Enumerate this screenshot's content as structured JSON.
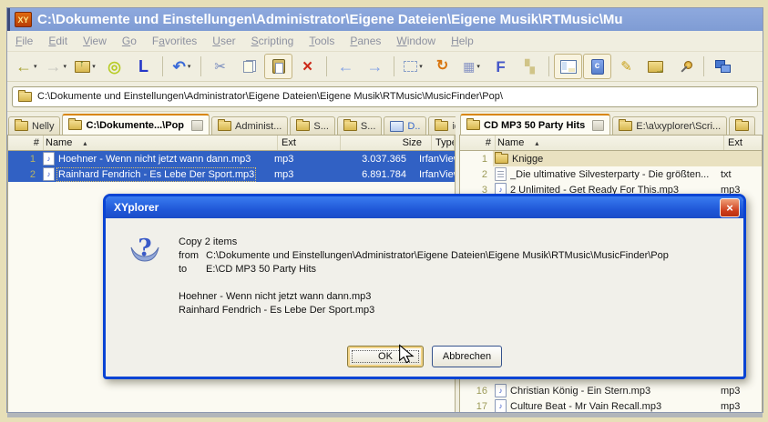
{
  "colors": {
    "selection": "#3161c4",
    "highlight": "#e9e1c0",
    "dialog_border": "#0a44d4",
    "tab_accent": "#d8860e",
    "titlebar": "#7f9cd4"
  },
  "window": {
    "logo": "XY",
    "title": "C:\\Dokumente und Einstellungen\\Administrator\\Eigene Dateien\\Eigene Musik\\RTMusic\\Mu"
  },
  "menu": {
    "items": [
      {
        "pre": "",
        "key": "F",
        "post": "ile"
      },
      {
        "pre": "",
        "key": "E",
        "post": "dit"
      },
      {
        "pre": "",
        "key": "V",
        "post": "iew"
      },
      {
        "pre": "",
        "key": "G",
        "post": "o"
      },
      {
        "pre": "F",
        "key": "a",
        "post": "vorites"
      },
      {
        "pre": "",
        "key": "U",
        "post": "ser"
      },
      {
        "pre": "",
        "key": "S",
        "post": "cripting"
      },
      {
        "pre": "",
        "key": "T",
        "post": "ools"
      },
      {
        "pre": "",
        "key": "P",
        "post": "anes"
      },
      {
        "pre": "",
        "key": "W",
        "post": "indow"
      },
      {
        "pre": "",
        "key": "H",
        "post": "elp"
      }
    ]
  },
  "toolbar": {
    "items": [
      {
        "name": "back-button",
        "glyph": "←",
        "color": "#a8a232",
        "size": 18,
        "bold": true,
        "caret": true
      },
      {
        "name": "forward-button",
        "glyph": "→",
        "color": "#c6c6be",
        "size": 18,
        "bold": true,
        "caret": true
      },
      {
        "name": "up-button",
        "css": "folder-up",
        "caret": true
      },
      {
        "name": "hotlist-button",
        "glyph": "◎",
        "color": "#b8cc28",
        "size": 17,
        "bold": true
      },
      {
        "name": "location-l-button",
        "glyph": "L",
        "color": "#2336c8",
        "size": 18,
        "bold": true
      },
      {
        "type": "sep"
      },
      {
        "name": "undo-button",
        "glyph": "↶",
        "color": "#3a6ad8",
        "size": 17,
        "bold": true,
        "caret": true
      },
      {
        "type": "sep"
      },
      {
        "name": "cut-button",
        "glyph": "✂",
        "color": "#7488bc",
        "size": 15
      },
      {
        "name": "copy-button",
        "css": "copy"
      },
      {
        "name": "paste-button",
        "css": "paste",
        "active": true
      },
      {
        "name": "delete-button",
        "glyph": "×",
        "color": "#cc2a1a",
        "size": 19,
        "bold": true
      },
      {
        "type": "sep"
      },
      {
        "name": "go-left-button",
        "glyph": "←",
        "color": "#84a2e4",
        "size": 18,
        "bold": true
      },
      {
        "name": "go-right-button",
        "glyph": "→",
        "color": "#84a2e4",
        "size": 18,
        "bold": true
      },
      {
        "type": "sep"
      },
      {
        "name": "select-button",
        "css": "select",
        "caret": true
      },
      {
        "name": "sync-button",
        "glyph": "↻",
        "color": "#d8740e",
        "size": 16,
        "bold": true
      },
      {
        "name": "views-button",
        "glyph": "▦",
        "color": "#8894c4",
        "size": 14,
        "caret": true
      },
      {
        "name": "filter-f-button",
        "glyph": "F",
        "color": "#4456c8",
        "size": 17,
        "bold": true
      },
      {
        "name": "checker-button",
        "glyph": "▚",
        "color": "#d0c488",
        "size": 14
      },
      {
        "type": "sep"
      },
      {
        "name": "panes-button",
        "css": "panes",
        "active": true
      },
      {
        "name": "catalog-button",
        "css": "catalog",
        "active": true
      },
      {
        "name": "edit-button",
        "glyph": "✎",
        "color": "#c8a018",
        "size": 15
      },
      {
        "name": "goto-folder-button",
        "css": "folder-go"
      },
      {
        "name": "pin-button",
        "css": "pin"
      },
      {
        "type": "sep"
      },
      {
        "name": "network-button",
        "css": "network"
      }
    ]
  },
  "addressbar": {
    "path": "C:\\Dokumente und Einstellungen\\Administrator\\Eigene Dateien\\Eigene Musik\\RTMusic\\MusicFinder\\Pop\\"
  },
  "left_tabs": [
    {
      "label": "Nelly",
      "icon": "folder"
    },
    {
      "label": "C:\\Dokumente...\\Pop",
      "icon": "folder",
      "active": true,
      "mini": true
    },
    {
      "label": "Administ...",
      "icon": "folder"
    },
    {
      "label": "S...",
      "icon": "folder"
    },
    {
      "label": "S...",
      "icon": "folder"
    },
    {
      "label": "D..",
      "icon": "desktop",
      "blue": true
    },
    {
      "label": "ico",
      "icon": "folder"
    }
  ],
  "right_tabs": [
    {
      "label": "CD MP3 50 Party Hits",
      "icon": "folder",
      "active": true,
      "mini": true
    },
    {
      "label": "E:\\a\\xyplorer\\Scri...",
      "icon": "folder"
    },
    {
      "label": "",
      "icon": "folder"
    }
  ],
  "left_pane": {
    "columns": [
      {
        "label": "#",
        "cls": "num"
      },
      {
        "label": "Name",
        "cls": "name",
        "sorted": true
      },
      {
        "label": "Ext",
        "cls": "ext"
      },
      {
        "label": "Size",
        "cls": "size"
      },
      {
        "label": "Type",
        "cls": "type"
      }
    ],
    "rows": [
      {
        "num": "1",
        "name": "Hoehner - Wenn nicht jetzt wann dann.mp3",
        "ext": "mp3",
        "size": "3.037.365",
        "type": "IrfanView M...",
        "kind": "mp3",
        "selected": true
      },
      {
        "num": "2",
        "name": "Rainhard Fendrich - Es Lebe Der Sport.mp3",
        "ext": "mp3",
        "size": "6.891.784",
        "type": "IrfanView M...",
        "kind": "mp3",
        "selected": true,
        "focused": true
      }
    ]
  },
  "right_pane": {
    "columns": [
      {
        "label": "#",
        "cls": "num"
      },
      {
        "label": "Name",
        "cls": "name",
        "sorted": true
      },
      {
        "label": "Ext",
        "cls": "ext"
      }
    ],
    "rows_top": [
      {
        "num": "1",
        "name": "Knigge",
        "ext": "",
        "kind": "folder",
        "highlight": true
      },
      {
        "num": "2",
        "name": "_Die ultimative Silvesterparty - Die größten...",
        "ext": "txt",
        "kind": "txt"
      },
      {
        "num": "3",
        "name": "2 Unlimited - Get Ready For This.mp3",
        "ext": "mp3",
        "kind": "mp3"
      }
    ],
    "rows_bottom": [
      {
        "num": "16",
        "name": "Christian König - Ein Stern.mp3",
        "ext": "mp3",
        "kind": "mp3"
      },
      {
        "num": "17",
        "name": "Culture Beat - Mr Vain Recall.mp3",
        "ext": "mp3",
        "kind": "mp3"
      },
      {
        "num": "",
        "name": "",
        "ext": "",
        "kind": "mp3"
      }
    ]
  },
  "dialog": {
    "title": "XYplorer",
    "close_glyph": "×",
    "message": "Copy 2 items",
    "paths": [
      {
        "prefix": "from",
        "path": "C:\\Dokumente und Einstellungen\\Administrator\\Eigene Dateien\\Eigene Musik\\RTMusic\\MusicFinder\\Pop"
      },
      {
        "prefix": "to",
        "path": "E:\\CD MP3 50 Party Hits"
      }
    ],
    "files": [
      "Hoehner - Wenn nicht jetzt wann dann.mp3",
      "Rainhard Fendrich - Es Lebe Der Sport.mp3"
    ],
    "buttons": {
      "ok": "OK",
      "cancel": "Abbrechen"
    }
  }
}
